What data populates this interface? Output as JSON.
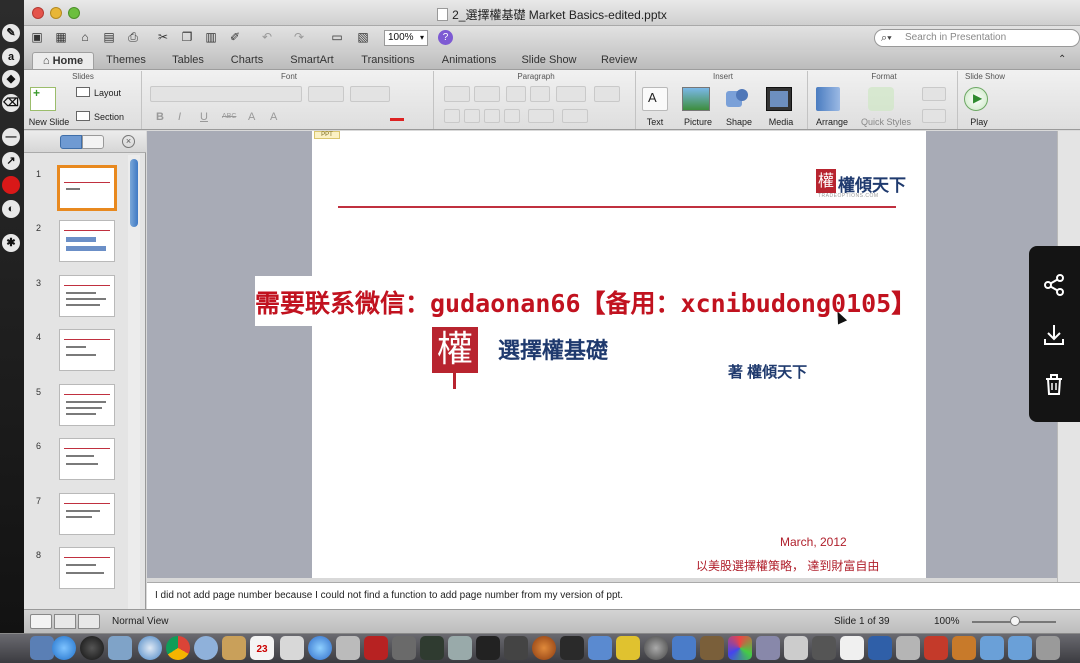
{
  "window": {
    "title": "2_選擇權基礎 Market Basics-edited.pptx",
    "zoom_value": "100%",
    "search_placeholder": "Search in Presentation"
  },
  "ribbon_tabs": [
    "Home",
    "Themes",
    "Tables",
    "Charts",
    "SmartArt",
    "Transitions",
    "Animations",
    "Slide Show",
    "Review"
  ],
  "ribbon": {
    "groups": {
      "slides": "Slides",
      "font": "Font",
      "paragraph": "Paragraph",
      "insert": "Insert",
      "format": "Format",
      "slide_show": "Slide Show"
    },
    "new_slide": "New Slide",
    "layout": "Layout",
    "section": "Section",
    "text": "Text",
    "picture": "Picture",
    "shape": "Shape",
    "media": "Media",
    "arrange": "Arrange",
    "quick_styles": "Quick Styles",
    "play": "Play",
    "font_buttons": [
      "B",
      "I",
      "U",
      "ABC",
      "A",
      "A"
    ]
  },
  "slides_list": [
    "1",
    "2",
    "3",
    "4",
    "5",
    "6",
    "7",
    "8"
  ],
  "slide": {
    "logo_text": "權傾天下",
    "logo_sub": "TRADEOPTIONS.COM",
    "seal_char": "權",
    "title": "選擇權基礎",
    "author": "著 權傾天下",
    "date": "March, 2012",
    "tagline": "以美股選擇權策略， 達到財富自由",
    "corner_tag": "PPT"
  },
  "watermark": "需要联系微信：gudaonan66【备用：xcnibudong0105】",
  "notes": "I did not add page number because I could not find a function to add page number from my version of ppt.",
  "status": {
    "view": "Normal View",
    "slide_counter": "Slide 1 of 39",
    "zoom": "100%"
  },
  "dock": {
    "calendar_day": "23"
  },
  "colors": {
    "accent_red": "#c1121f",
    "slide_title_blue": "#1f3a6e",
    "thumb_select": "#e8891f"
  }
}
